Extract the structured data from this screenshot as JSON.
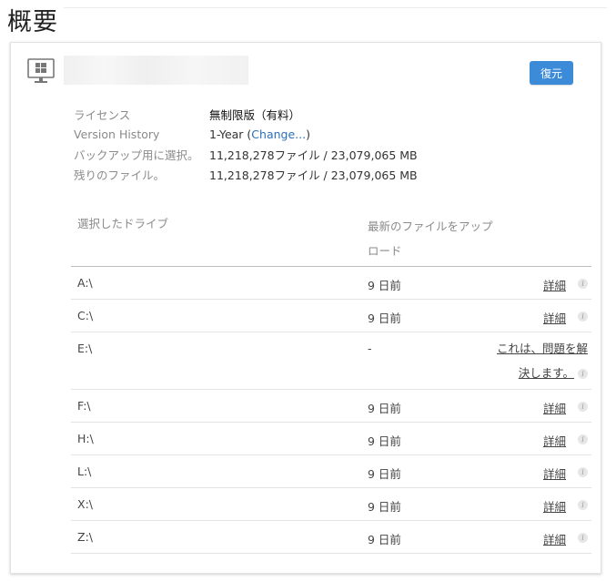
{
  "page": {
    "title": "概要"
  },
  "card": {
    "restore_label": "復元",
    "info": {
      "license_label": "ライセンス",
      "license_value": "無制限版（有料）",
      "version_label": "Version History",
      "version_value_prefix": "1-Year (",
      "version_link": "Change...",
      "version_value_suffix": ")",
      "selected_label": "バックアップ用に選択。",
      "selected_value": "11,218,278ファイル / 23,079,065 MB",
      "remaining_label": "残りのファイル。",
      "remaining_value": "11,218,278ファイル / 23,079,065 MB"
    },
    "table": {
      "col_drive": "選択したドライブ",
      "col_upload": "最新のファイルをアップロード",
      "rows": [
        {
          "drive": "A:\\",
          "date": "9 日前",
          "action": "詳細"
        },
        {
          "drive": "C:\\",
          "date": "9 日前",
          "action": "詳細"
        },
        {
          "drive": "E:\\",
          "date": "-",
          "action": "これは、問題を解決します。"
        },
        {
          "drive": "F:\\",
          "date": "9 日前",
          "action": "詳細"
        },
        {
          "drive": "H:\\",
          "date": "9 日前",
          "action": "詳細"
        },
        {
          "drive": "L:\\",
          "date": "9 日前",
          "action": "詳細"
        },
        {
          "drive": "X:\\",
          "date": "9 日前",
          "action": "詳細"
        },
        {
          "drive": "Z:\\",
          "date": "9 日前",
          "action": "詳細"
        }
      ]
    }
  },
  "icons": {
    "computer": "windows-computer-icon",
    "info": "info-icon"
  },
  "colors": {
    "accent": "#3b8bd9",
    "link": "#2a6fb8"
  }
}
